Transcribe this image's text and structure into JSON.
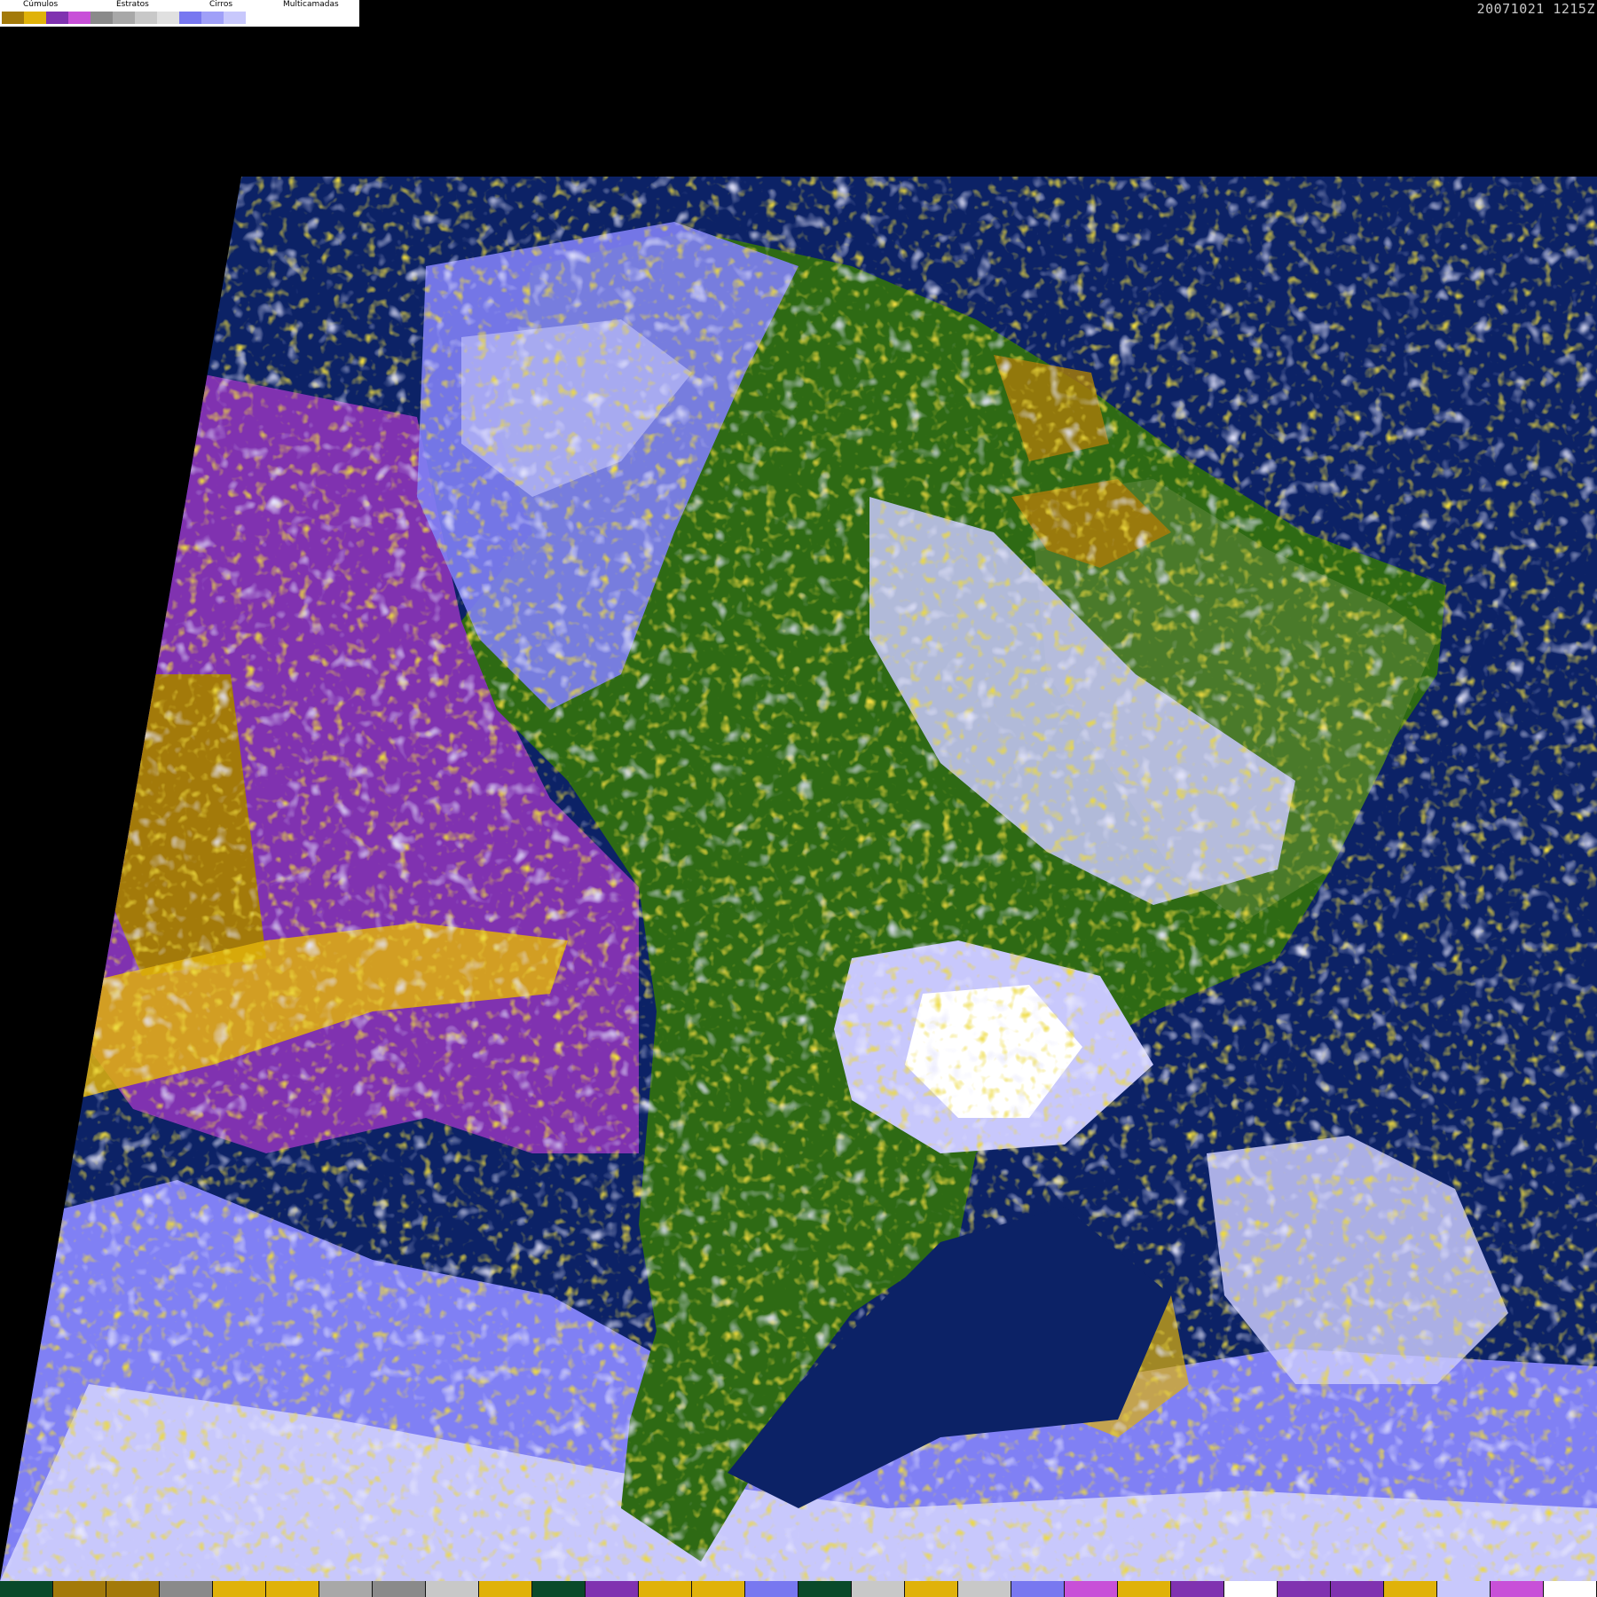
{
  "legend": {
    "groups": [
      {
        "label": "Cúmulos",
        "colors": [
          "#a37a0a",
          "#e0b20a"
        ]
      },
      {
        "label": "Estratos",
        "colors": [
          "#8032b0",
          "#c850d8"
        ]
      },
      {
        "label": "Cirros",
        "colors": [
          "#8a8a8a",
          "#a8a8a8",
          "#c8c8c8",
          "#e0e0e0"
        ]
      },
      {
        "label": "Multicamadas",
        "colors": [
          "#7878f0",
          "#a0a0f8",
          "#c8c8fc",
          "#ffffff"
        ]
      }
    ]
  },
  "timestamp": "20071021 1215Z",
  "colors": {
    "ocean": "#0c2266",
    "stratus": "#8032b0",
    "land": "#2e6a14",
    "land_light": "#4a7a2a",
    "cumulus_dark": "#a37a0a",
    "cumulus_light": "#e0b20a",
    "multilayer": "#8080f4",
    "multilayer_light": "#c8c8fc",
    "cirrus": "#a8a8a8",
    "white": "#f4f4ff"
  },
  "bottom_bar": [
    "#0a4a2a",
    "#a37a0a",
    "#a37a0a",
    "#8a8a8a",
    "#e0b20a",
    "#e0b20a",
    "#a8a8a8",
    "#8a8a8a",
    "#c8c8c8",
    "#e0b20a",
    "#0a4a2a",
    "#8032b0",
    "#e0b20a",
    "#e0b20a",
    "#7878f0",
    "#0a4a2a",
    "#c8c8c8",
    "#e0b20a",
    "#c8c8c8",
    "#7878f0",
    "#c850d8",
    "#e0b20a",
    "#8032b0",
    "#ffffff",
    "#8032b0",
    "#8032b0",
    "#e0b20a",
    "#c8c8fc",
    "#c850d8",
    "#ffffff"
  ]
}
